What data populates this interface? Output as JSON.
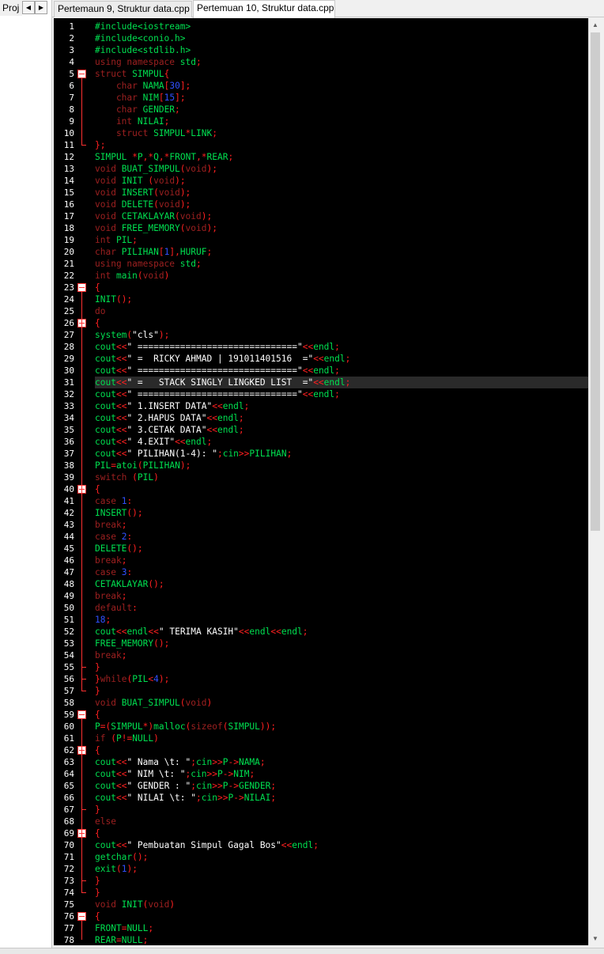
{
  "project_tab": "Proj",
  "nav": {
    "left": "◀",
    "right": "▶"
  },
  "tabs": [
    {
      "label": "Pertemaun 9, Struktur data.cpp",
      "active": false
    },
    {
      "label": "Pertemuan 10, Struktur data.cpp",
      "active": true
    }
  ],
  "editor": {
    "current_line": 31,
    "lines": [
      [
        [
          "p",
          "#include<iostream>"
        ]
      ],
      [
        [
          "p",
          "#include<conio.h>"
        ]
      ],
      [
        [
          "p",
          "#include<stdlib.h>"
        ]
      ],
      [
        [
          "k",
          "using namespace "
        ],
        [
          "g",
          "std"
        ],
        [
          "r",
          ";"
        ]
      ],
      [
        [
          "k",
          "struct "
        ],
        [
          "g",
          "SIMPUL"
        ],
        [
          "r",
          "{"
        ]
      ],
      [
        [
          "k",
          "    char "
        ],
        [
          "g",
          "NAMA"
        ],
        [
          "r",
          "["
        ],
        [
          "n",
          "30"
        ],
        [
          "r",
          "];"
        ]
      ],
      [
        [
          "k",
          "    char "
        ],
        [
          "g",
          "NIM"
        ],
        [
          "r",
          "["
        ],
        [
          "n",
          "15"
        ],
        [
          "r",
          "];"
        ]
      ],
      [
        [
          "k",
          "    char "
        ],
        [
          "g",
          "GENDER"
        ],
        [
          "r",
          ";"
        ]
      ],
      [
        [
          "k",
          "    int "
        ],
        [
          "g",
          "NILAI"
        ],
        [
          "r",
          ";"
        ]
      ],
      [
        [
          "k",
          "    struct "
        ],
        [
          "g",
          "SIMPUL"
        ],
        [
          "r",
          "*"
        ],
        [
          "g",
          "LINK"
        ],
        [
          "r",
          ";"
        ]
      ],
      [
        [
          "r",
          "};"
        ]
      ],
      [
        [
          "g",
          "SIMPUL "
        ],
        [
          "r",
          "*"
        ],
        [
          "g",
          "P"
        ],
        [
          "r",
          ",*"
        ],
        [
          "g",
          "Q"
        ],
        [
          "r",
          ",*"
        ],
        [
          "g",
          "FRONT"
        ],
        [
          "r",
          ",*"
        ],
        [
          "g",
          "REAR"
        ],
        [
          "r",
          ";"
        ]
      ],
      [
        [
          "k",
          "void "
        ],
        [
          "g",
          "BUAT_SIMPUL"
        ],
        [
          "r",
          "("
        ],
        [
          "k",
          "void"
        ],
        [
          "r",
          ");"
        ]
      ],
      [
        [
          "k",
          "void "
        ],
        [
          "g",
          "INIT "
        ],
        [
          "r",
          "("
        ],
        [
          "k",
          "void"
        ],
        [
          "r",
          ");"
        ]
      ],
      [
        [
          "k",
          "void "
        ],
        [
          "g",
          "INSERT"
        ],
        [
          "r",
          "("
        ],
        [
          "k",
          "void"
        ],
        [
          "r",
          ");"
        ]
      ],
      [
        [
          "k",
          "void "
        ],
        [
          "g",
          "DELETE"
        ],
        [
          "r",
          "("
        ],
        [
          "k",
          "void"
        ],
        [
          "r",
          ");"
        ]
      ],
      [
        [
          "k",
          "void "
        ],
        [
          "g",
          "CETAKLAYAR"
        ],
        [
          "r",
          "("
        ],
        [
          "k",
          "void"
        ],
        [
          "r",
          ");"
        ]
      ],
      [
        [
          "k",
          "void "
        ],
        [
          "g",
          "FREE_MEMORY"
        ],
        [
          "r",
          "("
        ],
        [
          "k",
          "void"
        ],
        [
          "r",
          ");"
        ]
      ],
      [
        [
          "k",
          "int "
        ],
        [
          "g",
          "PIL"
        ],
        [
          "r",
          ";"
        ]
      ],
      [
        [
          "k",
          "char "
        ],
        [
          "g",
          "PILIHAN"
        ],
        [
          "r",
          "["
        ],
        [
          "n",
          "1"
        ],
        [
          "r",
          "],"
        ],
        [
          "g",
          "HURUF"
        ],
        [
          "r",
          ";"
        ]
      ],
      [
        [
          "k",
          "using namespace "
        ],
        [
          "g",
          "std"
        ],
        [
          "r",
          ";"
        ]
      ],
      [
        [
          "k",
          "int "
        ],
        [
          "g",
          "main"
        ],
        [
          "r",
          "("
        ],
        [
          "k",
          "void"
        ],
        [
          "r",
          ")"
        ]
      ],
      [
        [
          "r",
          "{"
        ]
      ],
      [
        [
          "g",
          "INIT"
        ],
        [
          "r",
          "();"
        ]
      ],
      [
        [
          "k",
          "do"
        ]
      ],
      [
        [
          "r",
          "{"
        ]
      ],
      [
        [
          "g",
          "system"
        ],
        [
          "r",
          "("
        ],
        [
          "s",
          "\"cls\""
        ],
        [
          "r",
          ");"
        ]
      ],
      [
        [
          "g",
          "cout"
        ],
        [
          "r",
          "<<"
        ],
        [
          "s",
          "\" ==============================\""
        ],
        [
          "r",
          "<<"
        ],
        [
          "g",
          "endl"
        ],
        [
          "r",
          ";"
        ]
      ],
      [
        [
          "g",
          "cout"
        ],
        [
          "r",
          "<<"
        ],
        [
          "s",
          "\" =  RICKY AHMAD | 191011401516  =\""
        ],
        [
          "r",
          "<<"
        ],
        [
          "g",
          "endl"
        ],
        [
          "r",
          ";"
        ]
      ],
      [
        [
          "g",
          "cout"
        ],
        [
          "r",
          "<<"
        ],
        [
          "s",
          "\" ==============================\""
        ],
        [
          "r",
          "<<"
        ],
        [
          "g",
          "endl"
        ],
        [
          "r",
          ";"
        ]
      ],
      [
        [
          "g",
          "cout"
        ],
        [
          "r",
          "<<"
        ],
        [
          "s",
          "\" =   STACK SINGLY LINGKED LIST  =\""
        ],
        [
          "r",
          "<<"
        ],
        [
          "g",
          "endl"
        ],
        [
          "r",
          ";"
        ]
      ],
      [
        [
          "g",
          "cout"
        ],
        [
          "r",
          "<<"
        ],
        [
          "s",
          "\" ==============================\""
        ],
        [
          "r",
          "<<"
        ],
        [
          "g",
          "endl"
        ],
        [
          "r",
          ";"
        ]
      ],
      [
        [
          "g",
          "cout"
        ],
        [
          "r",
          "<<"
        ],
        [
          "s",
          "\" 1.INSERT DATA\""
        ],
        [
          "r",
          "<<"
        ],
        [
          "g",
          "endl"
        ],
        [
          "r",
          ";"
        ]
      ],
      [
        [
          "g",
          "cout"
        ],
        [
          "r",
          "<<"
        ],
        [
          "s",
          "\" 2.HAPUS DATA\""
        ],
        [
          "r",
          "<<"
        ],
        [
          "g",
          "endl"
        ],
        [
          "r",
          ";"
        ]
      ],
      [
        [
          "g",
          "cout"
        ],
        [
          "r",
          "<<"
        ],
        [
          "s",
          "\" 3.CETAK DATA\""
        ],
        [
          "r",
          "<<"
        ],
        [
          "g",
          "endl"
        ],
        [
          "r",
          ";"
        ]
      ],
      [
        [
          "g",
          "cout"
        ],
        [
          "r",
          "<<"
        ],
        [
          "s",
          "\" 4.EXIT\""
        ],
        [
          "r",
          "<<"
        ],
        [
          "g",
          "endl"
        ],
        [
          "r",
          ";"
        ]
      ],
      [
        [
          "g",
          "cout"
        ],
        [
          "r",
          "<<"
        ],
        [
          "s",
          "\" PILIHAN(1-4): \""
        ],
        [
          "r",
          ";"
        ],
        [
          "g",
          "cin"
        ],
        [
          "r",
          ">>"
        ],
        [
          "g",
          "PILIHAN"
        ],
        [
          "r",
          ";"
        ]
      ],
      [
        [
          "g",
          "PIL"
        ],
        [
          "r",
          "="
        ],
        [
          "g",
          "atoi"
        ],
        [
          "r",
          "("
        ],
        [
          "g",
          "PILIHAN"
        ],
        [
          "r",
          ");"
        ]
      ],
      [
        [
          "k",
          "switch "
        ],
        [
          "r",
          "("
        ],
        [
          "g",
          "PIL"
        ],
        [
          "r",
          ")"
        ]
      ],
      [
        [
          "r",
          "{"
        ]
      ],
      [
        [
          "k",
          "case "
        ],
        [
          "n",
          "1"
        ],
        [
          "r",
          ":"
        ]
      ],
      [
        [
          "g",
          "INSERT"
        ],
        [
          "r",
          "();"
        ]
      ],
      [
        [
          "k",
          "break"
        ],
        [
          "r",
          ";"
        ]
      ],
      [
        [
          "k",
          "case "
        ],
        [
          "n",
          "2"
        ],
        [
          "r",
          ":"
        ]
      ],
      [
        [
          "g",
          "DELETE"
        ],
        [
          "r",
          "();"
        ]
      ],
      [
        [
          "k",
          "break"
        ],
        [
          "r",
          ";"
        ]
      ],
      [
        [
          "k",
          "case "
        ],
        [
          "n",
          "3"
        ],
        [
          "r",
          ":"
        ]
      ],
      [
        [
          "g",
          "CETAKLAYAR"
        ],
        [
          "r",
          "();"
        ]
      ],
      [
        [
          "k",
          "break"
        ],
        [
          "r",
          ";"
        ]
      ],
      [
        [
          "k",
          "default"
        ],
        [
          "r",
          ":"
        ]
      ],
      [
        [
          "n",
          "18"
        ],
        [
          "r",
          ";"
        ]
      ],
      [
        [
          "g",
          "cout"
        ],
        [
          "r",
          "<<"
        ],
        [
          "g",
          "endl"
        ],
        [
          "r",
          "<<"
        ],
        [
          "s",
          "\" TERIMA KASIH\""
        ],
        [
          "r",
          "<<"
        ],
        [
          "g",
          "endl"
        ],
        [
          "r",
          "<<"
        ],
        [
          "g",
          "endl"
        ],
        [
          "r",
          ";"
        ]
      ],
      [
        [
          "g",
          "FREE_MEMORY"
        ],
        [
          "r",
          "();"
        ]
      ],
      [
        [
          "k",
          "break"
        ],
        [
          "r",
          ";"
        ]
      ],
      [
        [
          "r",
          "}"
        ]
      ],
      [
        [
          "r",
          "}"
        ],
        [
          "k",
          "while"
        ],
        [
          "r",
          "("
        ],
        [
          "g",
          "PIL"
        ],
        [
          "r",
          "<"
        ],
        [
          "n",
          "4"
        ],
        [
          "r",
          ");"
        ]
      ],
      [
        [
          "r",
          "}"
        ]
      ],
      [
        [
          "k",
          "void "
        ],
        [
          "g",
          "BUAT_SIMPUL"
        ],
        [
          "r",
          "("
        ],
        [
          "k",
          "void"
        ],
        [
          "r",
          ")"
        ]
      ],
      [
        [
          "r",
          "{"
        ]
      ],
      [
        [
          "g",
          "P"
        ],
        [
          "r",
          "=("
        ],
        [
          "g",
          "SIMPUL"
        ],
        [
          "r",
          "*)"
        ],
        [
          "g",
          "malloc"
        ],
        [
          "r",
          "("
        ],
        [
          "k",
          "sizeof"
        ],
        [
          "r",
          "("
        ],
        [
          "g",
          "SIMPUL"
        ],
        [
          "r",
          "));"
        ]
      ],
      [
        [
          "k",
          "if "
        ],
        [
          "r",
          "("
        ],
        [
          "g",
          "P"
        ],
        [
          "r",
          "!="
        ],
        [
          "g",
          "NULL"
        ],
        [
          "r",
          ")"
        ]
      ],
      [
        [
          "r",
          "{"
        ]
      ],
      [
        [
          "g",
          "cout"
        ],
        [
          "r",
          "<<"
        ],
        [
          "s",
          "\" Nama \\t: \""
        ],
        [
          "r",
          ";"
        ],
        [
          "g",
          "cin"
        ],
        [
          "r",
          ">>"
        ],
        [
          "g",
          "P"
        ],
        [
          "r",
          "->"
        ],
        [
          "g",
          "NAMA"
        ],
        [
          "r",
          ";"
        ]
      ],
      [
        [
          "g",
          "cout"
        ],
        [
          "r",
          "<<"
        ],
        [
          "s",
          "\" NIM \\t: \""
        ],
        [
          "r",
          ";"
        ],
        [
          "g",
          "cin"
        ],
        [
          "r",
          ">>"
        ],
        [
          "g",
          "P"
        ],
        [
          "r",
          "->"
        ],
        [
          "g",
          "NIM"
        ],
        [
          "r",
          ";"
        ]
      ],
      [
        [
          "g",
          "cout"
        ],
        [
          "r",
          "<<"
        ],
        [
          "s",
          "\" GENDER : \""
        ],
        [
          "r",
          ";"
        ],
        [
          "g",
          "cin"
        ],
        [
          "r",
          ">>"
        ],
        [
          "g",
          "P"
        ],
        [
          "r",
          "->"
        ],
        [
          "g",
          "GENDER"
        ],
        [
          "r",
          ";"
        ]
      ],
      [
        [
          "g",
          "cout"
        ],
        [
          "r",
          "<<"
        ],
        [
          "s",
          "\" NILAI \\t: \""
        ],
        [
          "r",
          ";"
        ],
        [
          "g",
          "cin"
        ],
        [
          "r",
          ">>"
        ],
        [
          "g",
          "P"
        ],
        [
          "r",
          "->"
        ],
        [
          "g",
          "NILAI"
        ],
        [
          "r",
          ";"
        ]
      ],
      [
        [
          "r",
          "}"
        ]
      ],
      [
        [
          "k",
          "else"
        ]
      ],
      [
        [
          "r",
          "{"
        ]
      ],
      [
        [
          "g",
          "cout"
        ],
        [
          "r",
          "<<"
        ],
        [
          "s",
          "\" Pembuatan Simpul Gagal Bos\""
        ],
        [
          "r",
          "<<"
        ],
        [
          "g",
          "endl"
        ],
        [
          "r",
          ";"
        ]
      ],
      [
        [
          "g",
          "getchar"
        ],
        [
          "r",
          "();"
        ]
      ],
      [
        [
          "g",
          "exit"
        ],
        [
          "r",
          "("
        ],
        [
          "n",
          "1"
        ],
        [
          "r",
          ");"
        ]
      ],
      [
        [
          "r",
          "}"
        ]
      ],
      [
        [
          "r",
          "}"
        ]
      ],
      [
        [
          "k",
          "void "
        ],
        [
          "g",
          "INIT"
        ],
        [
          "r",
          "("
        ],
        [
          "k",
          "void"
        ],
        [
          "r",
          ")"
        ]
      ],
      [
        [
          "r",
          "{"
        ]
      ],
      [
        [
          "g",
          "FRONT"
        ],
        [
          "r",
          "="
        ],
        [
          "g",
          "NULL"
        ],
        [
          "r",
          ";"
        ]
      ],
      [
        [
          "g",
          "REAR"
        ],
        [
          "r",
          "="
        ],
        [
          "g",
          "NULL"
        ],
        [
          "r",
          ";"
        ]
      ]
    ],
    "fold_open": [
      5,
      23,
      26,
      40,
      59,
      62,
      69,
      76
    ],
    "fold_end": [
      11,
      55,
      56,
      57,
      67,
      73,
      74
    ],
    "fold_ranges": [
      [
        5,
        11
      ],
      [
        23,
        57
      ],
      [
        26,
        56
      ],
      [
        40,
        55
      ],
      [
        59,
        74
      ],
      [
        62,
        67
      ],
      [
        69,
        73
      ],
      [
        76,
        78
      ]
    ]
  },
  "scrollbar": {
    "up": "▲",
    "down": "▼"
  }
}
